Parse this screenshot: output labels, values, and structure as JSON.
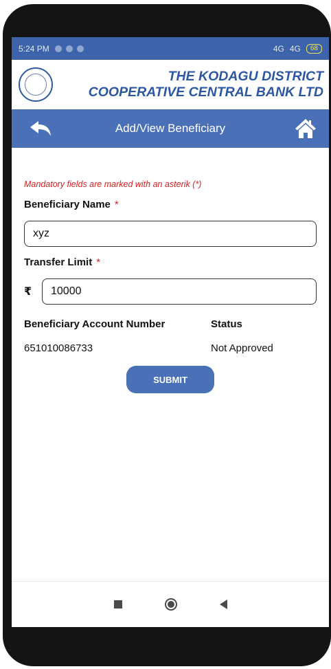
{
  "status_bar": {
    "time": "5:24 PM",
    "network_1": "4G",
    "network_2": "4G",
    "battery": "68"
  },
  "header": {
    "bank_name_line1": "THE KODAGU DISTRICT",
    "bank_name_line2": "COOPERATIVE CENTRAL BANK LTD"
  },
  "navbar": {
    "title": "Add/View Beneficiary",
    "back_icon": "back-arrow-icon",
    "home_icon": "home-icon"
  },
  "form": {
    "mandatory_note": "Mandatory fields are marked with an asterik (*)",
    "name_label": "Beneficiary Name",
    "name_value": "xyz",
    "limit_label": "Transfer Limit",
    "currency_symbol": "₹",
    "limit_value": "10000",
    "asterisk": "*"
  },
  "account": {
    "number_header": "Beneficiary Account Number",
    "status_header": "Status",
    "number": "651010086733",
    "status": "Not Approved"
  },
  "submit_label": "SUBMIT",
  "colors": {
    "primary": "#4a70b8",
    "bank_text": "#2c57a3",
    "required": "#d52020"
  }
}
